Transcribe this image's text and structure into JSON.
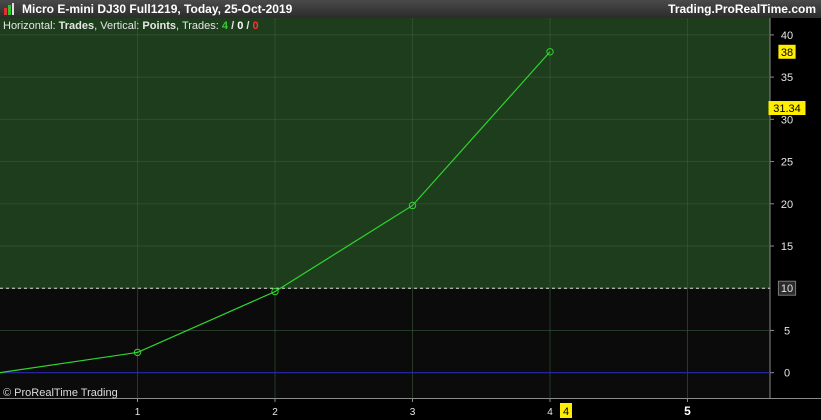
{
  "header": {
    "title": "Micro E-mini DJ30 Full1219, Today, 25-Oct-2019",
    "brand": "Trading.ProRealTime.com"
  },
  "info": {
    "horizontal_label": "Horizontal: ",
    "horizontal_value": "Trades",
    "vertical_label": ", Vertical: ",
    "vertical_value": "Points",
    "trades_label": ", Trades: ",
    "trades_total": "4",
    "sep1": " / ",
    "trades_mid": "0",
    "sep2": " / ",
    "trades_losing": "0"
  },
  "footer": {
    "copyright": "© ProRealTime Trading"
  },
  "colors": {
    "upper_zone": "#1d3d1d",
    "lower_zone": "#0b0b0b",
    "line": "#2ed62e",
    "zero_line": "#2a2ab0",
    "threshold": "#d6e6cc",
    "grid": "#3a5a3a",
    "highlight": "#ffee00",
    "trades_total": "#33cc33",
    "trades_mid": "#ffffff",
    "trades_losing": "#ff3333"
  },
  "chart_data": {
    "type": "line",
    "x": [
      0,
      1,
      2,
      3,
      4
    ],
    "series": [
      {
        "values": [
          0,
          2.4,
          9.6,
          19.8,
          38
        ]
      }
    ],
    "xlim": [
      0,
      5.6
    ],
    "ylim": [
      -3,
      42
    ],
    "x_ticks": [
      1,
      2,
      3,
      4,
      5
    ],
    "y_ticks": [
      0,
      5,
      10,
      15,
      20,
      25,
      30,
      35,
      40
    ],
    "threshold": "10",
    "last_value": "38",
    "current_value": "31.34",
    "current_value_num": 31.34,
    "x_marker": "4"
  }
}
